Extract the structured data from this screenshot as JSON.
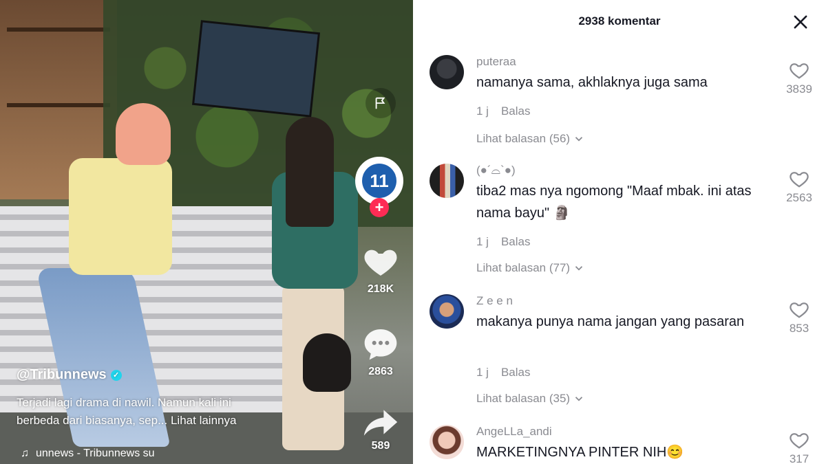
{
  "video": {
    "handle": "@Tribunnews",
    "caption_line1": "Terjadi lagi drama di nawil. Namun kali ini",
    "caption_line2": "berbeda dari biasanya, sep... Lihat lainnya",
    "music": "unnews - Tribunnews   su",
    "avatar_text": "11",
    "likes": "218K",
    "comments": "2863",
    "shares": "589",
    "icons": {
      "report": "flag-icon",
      "follow": "plus-icon",
      "like": "heart-icon",
      "comment": "comment-bubble-icon",
      "share": "share-arrow-icon",
      "music": "music-note-icon",
      "verified": "verified-check-icon"
    }
  },
  "panel": {
    "title": "2938 komentar",
    "close_icon": "close-icon"
  },
  "comments": [
    {
      "user": "puteraa",
      "text": "namanya sama, akhlaknya juga sama",
      "time": "1 j",
      "reply_label": "Balas",
      "view_replies": "Lihat balasan (56)",
      "likes": "3839"
    },
    {
      "user": "(●´⌓`●)",
      "text": "tiba2 mas nya ngomong \"Maaf mbak. ini atas nama bayu\" 🗿",
      "time": "1 j",
      "reply_label": "Balas",
      "view_replies": "Lihat balasan (77)",
      "likes": "2563"
    },
    {
      "user": "Z e e n",
      "text": "makanya punya nama jangan yang pasaran",
      "time": "1 j",
      "reply_label": "Balas",
      "view_replies": "Lihat balasan (35)",
      "likes": "853"
    },
    {
      "user": "AngeLLa_andi",
      "text": "MARKETINGNYA PINTER NIH😊",
      "likes": "317"
    }
  ],
  "colors": {
    "accent": "#fe2c55",
    "text_primary": "#161823",
    "text_secondary": "#8a8b91"
  }
}
